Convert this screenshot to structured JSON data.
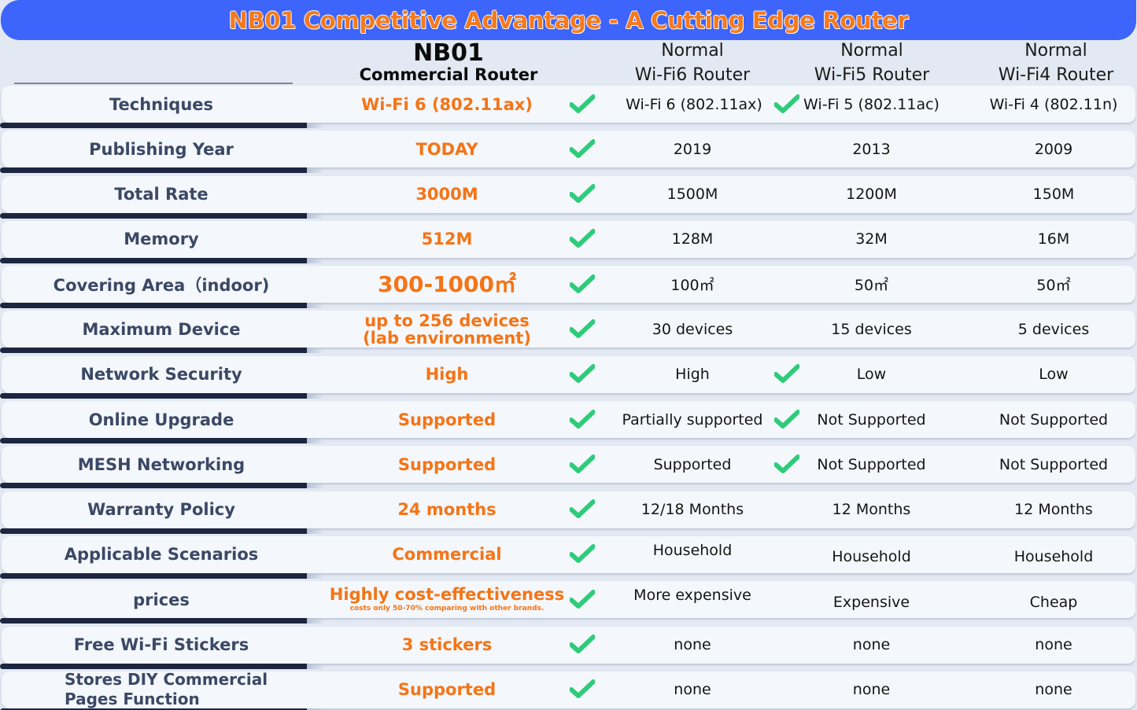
{
  "title": "NB01 Competitive Advantage - A Cutting Edge Router",
  "colors": {
    "title_bar": "#3d64fb",
    "title_text": "#f57a1d",
    "highlight_text": "#f57416",
    "check": "#2ecc7a",
    "label_text": "#3b4866",
    "row_bar": "#1d2640"
  },
  "columns": {
    "nb01": {
      "line1": "NB01",
      "line2": "Commercial Router"
    },
    "wifi6": {
      "line1": "Normal",
      "line2": "Wi-Fi6 Router"
    },
    "wifi5": {
      "line1": "Normal",
      "line2": "Wi-Fi5 Router"
    },
    "wifi4": {
      "line1": "Normal",
      "line2": "Wi-Fi4 Router"
    }
  },
  "rows": [
    {
      "label": "Techniques",
      "nb01": "Wi-Fi 6 (802.11ax)",
      "nb01_sub": "",
      "wifi6": "Wi-Fi 6 (802.11ax)",
      "wifi5": "Wi-Fi 5 (802.11ac)",
      "wifi4": "Wi-Fi 4 (802.11n)",
      "nb01_check": true,
      "wifi6_check": true
    },
    {
      "label": "Publishing Year",
      "nb01": "TODAY",
      "nb01_sub": "",
      "wifi6": "2019",
      "wifi5": "2013",
      "wifi4": "2009",
      "nb01_check": true,
      "wifi6_check": false
    },
    {
      "label": "Total Rate",
      "nb01": "3000M",
      "nb01_sub": "",
      "wifi6": "1500M",
      "wifi5": "1200M",
      "wifi4": "150M",
      "nb01_check": true,
      "wifi6_check": false
    },
    {
      "label": "Memory",
      "nb01": "512M",
      "nb01_sub": "",
      "wifi6": "128M",
      "wifi5": "32M",
      "wifi4": "16M",
      "nb01_check": true,
      "wifi6_check": false
    },
    {
      "label": "Covering Area（indoor)",
      "nb01": "300-1000㎡",
      "nb01_sub": "",
      "wifi6": "100㎡",
      "wifi5": "50㎡",
      "wifi4": "50㎡",
      "nb01_check": true,
      "wifi6_check": false
    },
    {
      "label": "Maximum Device",
      "nb01": "up to 256 devices",
      "nb01_sub": "(lab environment)",
      "wifi6": "30 devices",
      "wifi5": "15 devices",
      "wifi4": "5 devices",
      "nb01_check": true,
      "wifi6_check": false
    },
    {
      "label": "Network Security",
      "nb01": "High",
      "nb01_sub": "",
      "wifi6": "High",
      "wifi5": "Low",
      "wifi4": "Low",
      "nb01_check": true,
      "wifi6_check": true
    },
    {
      "label": "Online Upgrade",
      "nb01": "Supported",
      "nb01_sub": "",
      "wifi6": "Partially supported",
      "wifi5": "Not Supported",
      "wifi4": "Not Supported",
      "nb01_check": true,
      "wifi6_check": true
    },
    {
      "label": "MESH Networking",
      "nb01": "Supported",
      "nb01_sub": "",
      "wifi6": "Supported",
      "wifi5": "Not Supported",
      "wifi4": "Not Supported",
      "nb01_check": true,
      "wifi6_check": true
    },
    {
      "label": "Warranty Policy",
      "nb01": "24 months",
      "nb01_sub": "",
      "wifi6": "12/18 Months",
      "wifi5": "12 Months",
      "wifi4": "12 Months",
      "nb01_check": true,
      "wifi6_check": false
    },
    {
      "label": "Applicable Scenarios",
      "nb01": "Commercial",
      "nb01_sub": "",
      "wifi6": "Household",
      "wifi5": "Household",
      "wifi4": "Household",
      "nb01_check": true,
      "wifi6_check": false
    },
    {
      "label": "prices",
      "nb01": "Highly cost-effectiveness",
      "nb01_sub": "costs only 50-70% comparing with other brands.",
      "wifi6": "More expensive",
      "wifi5": "Expensive",
      "wifi4": "Cheap",
      "nb01_check": true,
      "wifi6_check": false
    },
    {
      "label": "Free Wi-Fi Stickers",
      "nb01": "3 stickers",
      "nb01_sub": "",
      "wifi6": "none",
      "wifi5": "none",
      "wifi4": "none",
      "nb01_check": true,
      "wifi6_check": false
    },
    {
      "label": "Stores DIY Commercial Pages Function",
      "nb01": "Supported",
      "nb01_sub": "",
      "wifi6": "none",
      "wifi5": "none",
      "wifi4": "none",
      "nb01_check": true,
      "wifi6_check": false
    }
  ]
}
